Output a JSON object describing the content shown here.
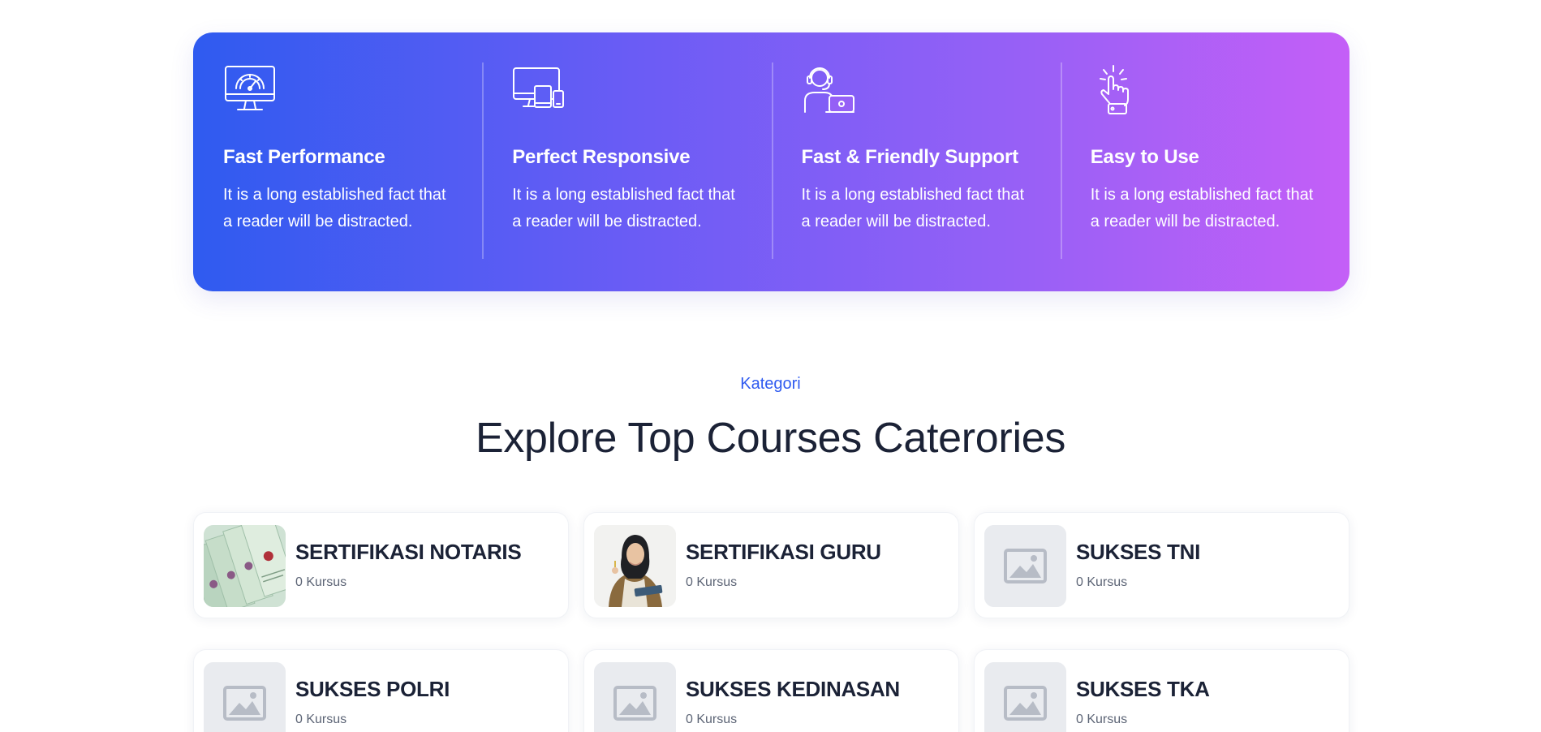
{
  "features": [
    {
      "icon": "speedometer-monitor-icon",
      "title": "Fast Performance",
      "text": "It is a long established fact that a reader will be distracted."
    },
    {
      "icon": "devices-icon",
      "title": "Perfect Responsive",
      "text": "It is a long established fact that a reader will be distracted."
    },
    {
      "icon": "support-agent-icon",
      "title": "Fast & Friendly Support",
      "text": "It is a long established fact that a reader will be distracted."
    },
    {
      "icon": "tap-hand-icon",
      "title": "Easy to Use",
      "text": "It is a long established fact that a reader will be distracted."
    }
  ],
  "categories_section": {
    "eyebrow": "Kategori",
    "title": "Explore Top Courses Caterories"
  },
  "categories": [
    {
      "title": "SERTIFIKASI NOTARIS",
      "count": "0 Kursus",
      "image": "certificate-photo"
    },
    {
      "title": "SERTIFIKASI GURU",
      "count": "0 Kursus",
      "image": "teacher-photo"
    },
    {
      "title": "SUKSES TNI",
      "count": "0 Kursus",
      "image": "image-placeholder-icon"
    },
    {
      "title": "SUKSES POLRI",
      "count": "0 Kursus",
      "image": "image-placeholder-icon"
    },
    {
      "title": "SUKSES KEDINASAN",
      "count": "0 Kursus",
      "image": "image-placeholder-icon"
    },
    {
      "title": "SUKSES TKA",
      "count": "0 Kursus",
      "image": "image-placeholder-icon"
    }
  ],
  "colors": {
    "accent": "#2f5bf0",
    "gradient_start": "#2f5bf0",
    "gradient_end": "#c45ff7",
    "heading": "#1b2236",
    "muted": "#5d6576"
  }
}
